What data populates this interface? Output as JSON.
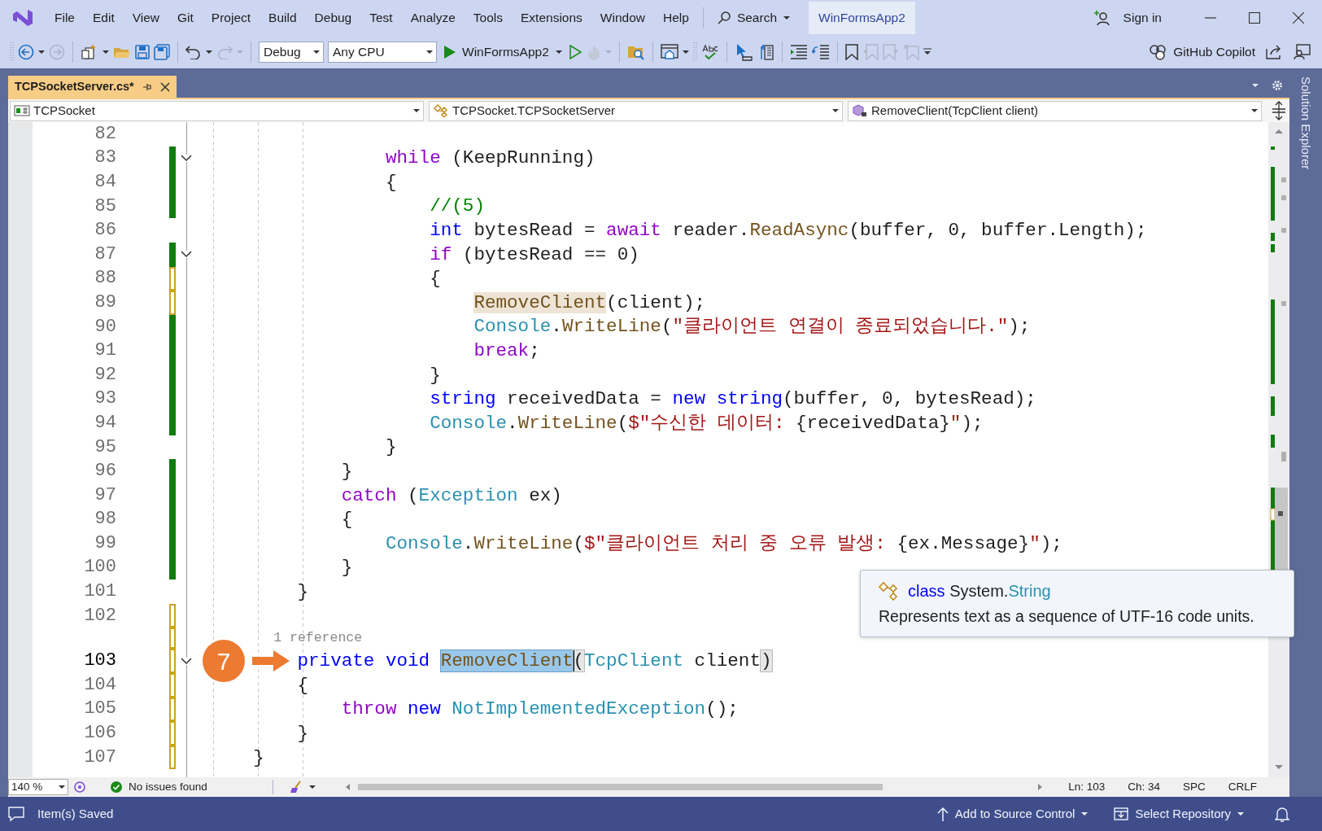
{
  "menu": [
    "File",
    "Edit",
    "View",
    "Git",
    "Project",
    "Build",
    "Debug",
    "Test",
    "Analyze",
    "Tools",
    "Extensions",
    "Window",
    "Help"
  ],
  "search": {
    "label": "Search"
  },
  "window": {
    "title": "WinFormsApp2"
  },
  "account": {
    "label": "Sign in"
  },
  "toolbar": {
    "configuration": "Debug",
    "platform": "Any CPU",
    "start_target": "WinFormsApp2",
    "copilot": "GitHub Copilot"
  },
  "document_tabs": [
    {
      "label": "TCPSocketServer.cs*",
      "selected": true
    }
  ],
  "navigation_bar": {
    "project": "TCPSocket",
    "type": "TCPSocket.TCPSocketServer",
    "member": "RemoveClient(TcpClient client)"
  },
  "editor": {
    "lines": [
      {
        "number": "82",
        "changed": false,
        "fold": false,
        "current": false
      },
      {
        "number": "83",
        "changed": true,
        "saved": true,
        "fold": true,
        "current": false,
        "tokens": [
          {
            "text": "                while",
            "kind": "control"
          },
          {
            "text": " (KeepRunning)",
            "kind": "plain"
          }
        ]
      },
      {
        "number": "84",
        "changed": true,
        "saved": true,
        "fold": false,
        "current": false,
        "tokens": [
          {
            "text": "                {",
            "kind": "plain"
          }
        ]
      },
      {
        "number": "85",
        "changed": true,
        "saved": true,
        "fold": false,
        "current": false,
        "tokens": [
          {
            "text": "                    //(5)",
            "kind": "comment"
          }
        ]
      },
      {
        "number": "86",
        "changed": false,
        "fold": false,
        "current": false,
        "tokens": [
          {
            "text": "                    int",
            "kind": "keyword"
          },
          {
            "text": " bytesRead = ",
            "kind": "plain"
          },
          {
            "text": "await",
            "kind": "control"
          },
          {
            "text": " reader.",
            "kind": "plain"
          },
          {
            "text": "ReadAsync",
            "kind": "method"
          },
          {
            "text": "(buffer, 0, buffer.Length);",
            "kind": "plain"
          }
        ]
      },
      {
        "number": "87",
        "changed": true,
        "saved": true,
        "fold": true,
        "current": false,
        "tokens": [
          {
            "text": "                    if",
            "kind": "control"
          },
          {
            "text": " (bytesRead == 0)",
            "kind": "plain"
          }
        ]
      },
      {
        "number": "88",
        "changed": true,
        "saved": false,
        "fold": false,
        "current": false,
        "tokens": [
          {
            "text": "                    {",
            "kind": "plain"
          }
        ]
      },
      {
        "number": "89",
        "changed": true,
        "saved": false,
        "fold": false,
        "current": false,
        "tokens": [
          {
            "text": "                        RemoveClient",
            "kind": "method",
            "referenced": true
          },
          {
            "text": "(client);",
            "kind": "plain"
          }
        ]
      },
      {
        "number": "90",
        "changed": true,
        "saved": true,
        "fold": false,
        "current": false,
        "tokens": [
          {
            "text": "                        Console",
            "kind": "type"
          },
          {
            "text": ".",
            "kind": "plain"
          },
          {
            "text": "WriteLine",
            "kind": "method"
          },
          {
            "text": "(",
            "kind": "plain"
          },
          {
            "text": "\"클라이언트 연결이 종료되었습니다.\"",
            "kind": "string"
          },
          {
            "text": ");",
            "kind": "plain"
          }
        ]
      },
      {
        "number": "91",
        "changed": true,
        "saved": true,
        "fold": false,
        "current": false,
        "tokens": [
          {
            "text": "                        break",
            "kind": "control"
          },
          {
            "text": ";",
            "kind": "plain"
          }
        ]
      },
      {
        "number": "92",
        "changed": true,
        "saved": true,
        "fold": false,
        "current": false,
        "tokens": [
          {
            "text": "                    }",
            "kind": "plain"
          }
        ]
      },
      {
        "number": "93",
        "changed": true,
        "saved": true,
        "fold": false,
        "current": false,
        "tokens": [
          {
            "text": "                    string",
            "kind": "keyword"
          },
          {
            "text": " receivedData = ",
            "kind": "plain"
          },
          {
            "text": "new",
            "kind": "keyword"
          },
          {
            "text": " string",
            "kind": "keyword"
          },
          {
            "text": "(buffer, 0, bytesRead);",
            "kind": "plain"
          }
        ]
      },
      {
        "number": "94",
        "changed": true,
        "saved": true,
        "fold": false,
        "current": false,
        "tokens": [
          {
            "text": "                    Console",
            "kind": "type"
          },
          {
            "text": ".",
            "kind": "plain"
          },
          {
            "text": "WriteLine",
            "kind": "method"
          },
          {
            "text": "(",
            "kind": "plain"
          },
          {
            "text": "$\"수신한 데이터: ",
            "kind": "string"
          },
          {
            "text": "{receivedData}",
            "kind": "plain"
          },
          {
            "text": "\"",
            "kind": "string"
          },
          {
            "text": ");",
            "kind": "plain"
          }
        ]
      },
      {
        "number": "95",
        "changed": false,
        "fold": false,
        "current": false,
        "tokens": [
          {
            "text": "                }",
            "kind": "plain"
          }
        ]
      },
      {
        "number": "96",
        "changed": true,
        "saved": true,
        "fold": false,
        "current": false,
        "tokens": [
          {
            "text": "            }",
            "kind": "plain"
          }
        ]
      },
      {
        "number": "97",
        "changed": true,
        "saved": true,
        "fold": false,
        "current": false,
        "tokens": [
          {
            "text": "            catch",
            "kind": "control"
          },
          {
            "text": " (",
            "kind": "plain"
          },
          {
            "text": "Exception",
            "kind": "type"
          },
          {
            "text": " ex)",
            "kind": "plain"
          }
        ]
      },
      {
        "number": "98",
        "changed": true,
        "saved": true,
        "fold": false,
        "current": false,
        "tokens": [
          {
            "text": "            {",
            "kind": "plain"
          }
        ]
      },
      {
        "number": "99",
        "changed": true,
        "saved": true,
        "fold": false,
        "current": false,
        "tokens": [
          {
            "text": "                Console",
            "kind": "type"
          },
          {
            "text": ".",
            "kind": "plain"
          },
          {
            "text": "WriteLine",
            "kind": "method"
          },
          {
            "text": "(",
            "kind": "plain"
          },
          {
            "text": "$\"클라이언트 처리 중 오류 발생: ",
            "kind": "string"
          },
          {
            "text": "{ex.Message}",
            "kind": "plain"
          },
          {
            "text": "\"",
            "kind": "string"
          },
          {
            "text": ");",
            "kind": "plain"
          }
        ]
      },
      {
        "number": "100",
        "changed": true,
        "saved": true,
        "fold": false,
        "current": false,
        "tokens": [
          {
            "text": "            }",
            "kind": "plain"
          }
        ]
      },
      {
        "number": "101",
        "changed": false,
        "fold": false,
        "current": false,
        "tokens": [
          {
            "text": "        }",
            "kind": "plain"
          }
        ]
      },
      {
        "number": "102",
        "changed": true,
        "saved": false,
        "fold": false,
        "current": false
      },
      {
        "number": "103",
        "changed": true,
        "saved": false,
        "fold": true,
        "current": true,
        "codelens": "1 reference",
        "callout": "7",
        "tokens": [
          {
            "text": "        private",
            "kind": "keyword"
          },
          {
            "text": " void ",
            "kind": "keyword"
          },
          {
            "text": "RemoveClient",
            "kind": "method",
            "selected": true
          },
          {
            "text": "(",
            "kind": "plain",
            "matched": true,
            "caret": true
          },
          {
            "text": "TcpClient",
            "kind": "type"
          },
          {
            "text": " client",
            "kind": "plain"
          },
          {
            "text": ")",
            "kind": "plain",
            "matched": true
          }
        ]
      },
      {
        "number": "104",
        "changed": true,
        "saved": false,
        "fold": false,
        "current": false,
        "tokens": [
          {
            "text": "        {",
            "kind": "plain"
          }
        ]
      },
      {
        "number": "105",
        "changed": true,
        "saved": false,
        "fold": false,
        "current": false,
        "tokens": [
          {
            "text": "            throw",
            "kind": "control"
          },
          {
            "text": " new",
            "kind": "keyword"
          },
          {
            "text": " NotImplementedException",
            "kind": "type"
          },
          {
            "text": "();",
            "kind": "plain"
          }
        ]
      },
      {
        "number": "106",
        "changed": true,
        "saved": false,
        "fold": false,
        "current": false,
        "tokens": [
          {
            "text": "        }",
            "kind": "plain"
          }
        ]
      },
      {
        "number": "107",
        "changed": true,
        "saved": false,
        "fold": false,
        "current": false,
        "tokens": [
          {
            "text": "    }",
            "kind": "plain"
          }
        ]
      }
    ],
    "tooltip": {
      "signature": [
        {
          "text": "class",
          "kind": "keyword"
        },
        {
          "text": " System.",
          "kind": "plain"
        },
        {
          "text": "String",
          "kind": "type"
        }
      ],
      "description": "Represents text as a sequence of UTF-16 code units."
    }
  },
  "side_panel": {
    "label": "Solution Explorer"
  },
  "editor_status": {
    "zoom": "140 %",
    "issues": "No issues found",
    "line": "Ln: 103",
    "column": "Ch: 34",
    "whitespace": "SPC",
    "line_ending": "CRLF"
  },
  "status_bar": {
    "message": "Item(s) Saved",
    "source_control": "Add to Source Control",
    "repository": "Select Repository"
  }
}
